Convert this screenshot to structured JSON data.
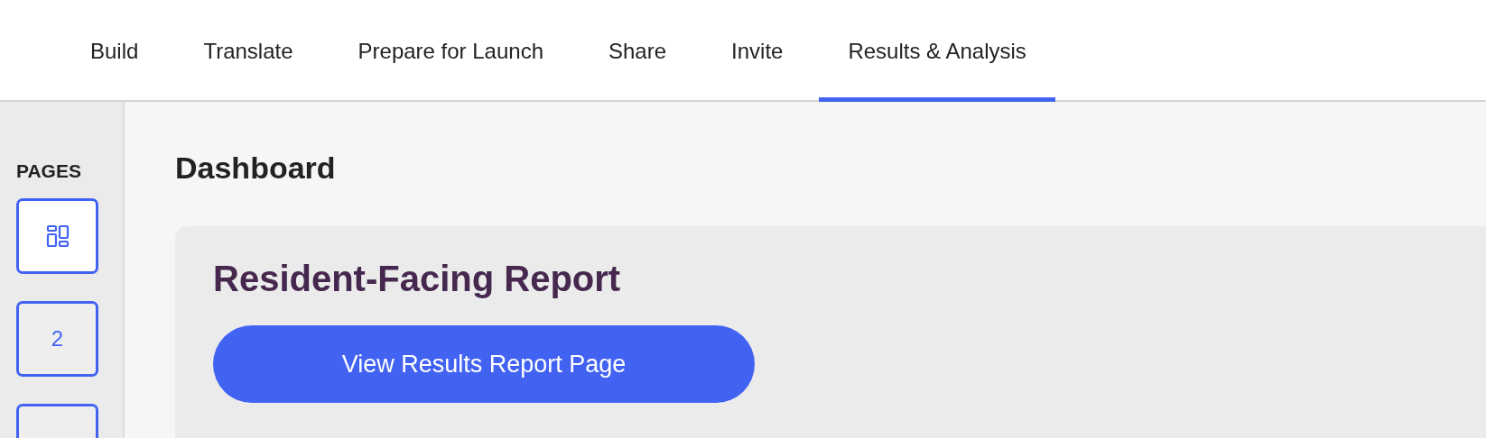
{
  "tabs": [
    {
      "label": "Build",
      "selected": false
    },
    {
      "label": "Translate",
      "selected": false
    },
    {
      "label": "Prepare for Launch",
      "selected": false
    },
    {
      "label": "Share",
      "selected": false
    },
    {
      "label": "Invite",
      "selected": false
    },
    {
      "label": "Results & Analysis",
      "selected": true
    }
  ],
  "sidebar": {
    "title": "PAGES",
    "pages": [
      {
        "kind": "dashboard",
        "selected": true
      },
      {
        "kind": "number",
        "label": "2",
        "selected": false
      },
      {
        "kind": "number",
        "selected": false
      }
    ]
  },
  "main": {
    "title": "Dashboard",
    "card": {
      "title": "Resident-Facing Report",
      "button": "View Results Report Page"
    }
  }
}
